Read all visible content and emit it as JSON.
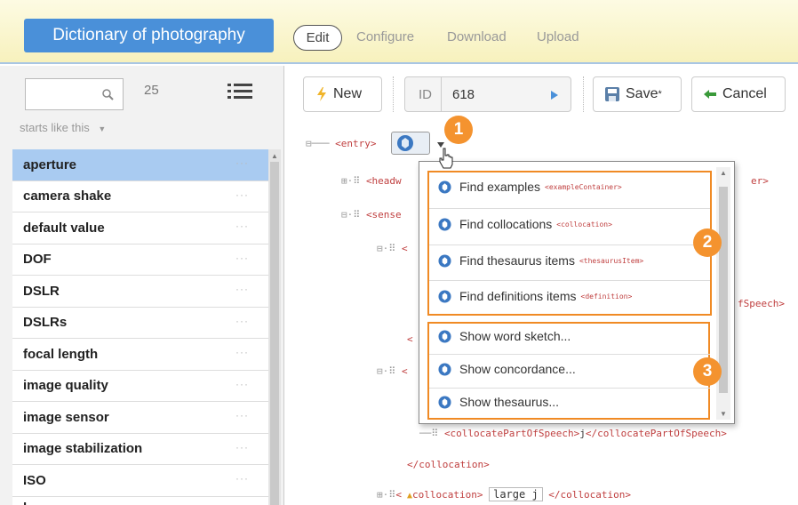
{
  "header": {
    "app_title": "Dictionary of photography",
    "edit": "Edit",
    "nav": [
      "Configure",
      "Download",
      "Upload"
    ]
  },
  "sidebar": {
    "search_value": "",
    "count": "25",
    "filter": "starts like this",
    "entries": [
      "aperture",
      "camera shake",
      "default value",
      "DOF",
      "DSLR",
      "DSLRs",
      "focal length",
      "image quality",
      "image sensor",
      "image stabilization",
      "ISO",
      "lens"
    ],
    "selected": "aperture",
    "more": "···"
  },
  "toolbar": {
    "new": "New",
    "id_label": "ID",
    "id_value": "618",
    "save": "Save",
    "save_mark": "*",
    "cancel": "Cancel"
  },
  "tree": {
    "entry": "<entry>",
    "headword_tag": "<headw",
    "headword_end": "er>",
    "sense_tag": "<sense",
    "frag_1": "<",
    "frag_2": "fSpeech>",
    "frag_3": "<",
    "frag_4": "<",
    "cps_open": "<collocatePartOfSpeech>",
    "cps_value": "j",
    "cps_close": "</collocatePartOfSpeech>",
    "colloc_close": "</collocation>",
    "colloc_open": "collocation>",
    "colloc_value": "large j",
    "colloc_end": "</collocation>",
    "lt": "<"
  },
  "menu": {
    "group1": [
      {
        "label": "Find examples",
        "tag": "<exampleContainer>"
      },
      {
        "label": "Find collocations",
        "tag": "<collocation>"
      },
      {
        "label": "Find thesaurus items",
        "tag": "<thesaurusItem>"
      },
      {
        "label": "Find definitions items",
        "tag": "<definition>"
      }
    ],
    "group2": [
      {
        "label": "Show word sketch..."
      },
      {
        "label": "Show concordance..."
      },
      {
        "label": "Show thesaurus..."
      }
    ]
  },
  "callouts": [
    "1",
    "2",
    "3"
  ],
  "colors": {
    "accent": "#4a90d9",
    "callout": "#f4932f",
    "selected": "#a9cbf1",
    "tag": "#c04040"
  },
  "icons": [
    "search-icon",
    "list-icon",
    "lightning-icon",
    "play-icon",
    "save-icon",
    "cancel-icon",
    "sketch-engine-icon",
    "dropdown-arrow-icon",
    "cursor-icon"
  ]
}
